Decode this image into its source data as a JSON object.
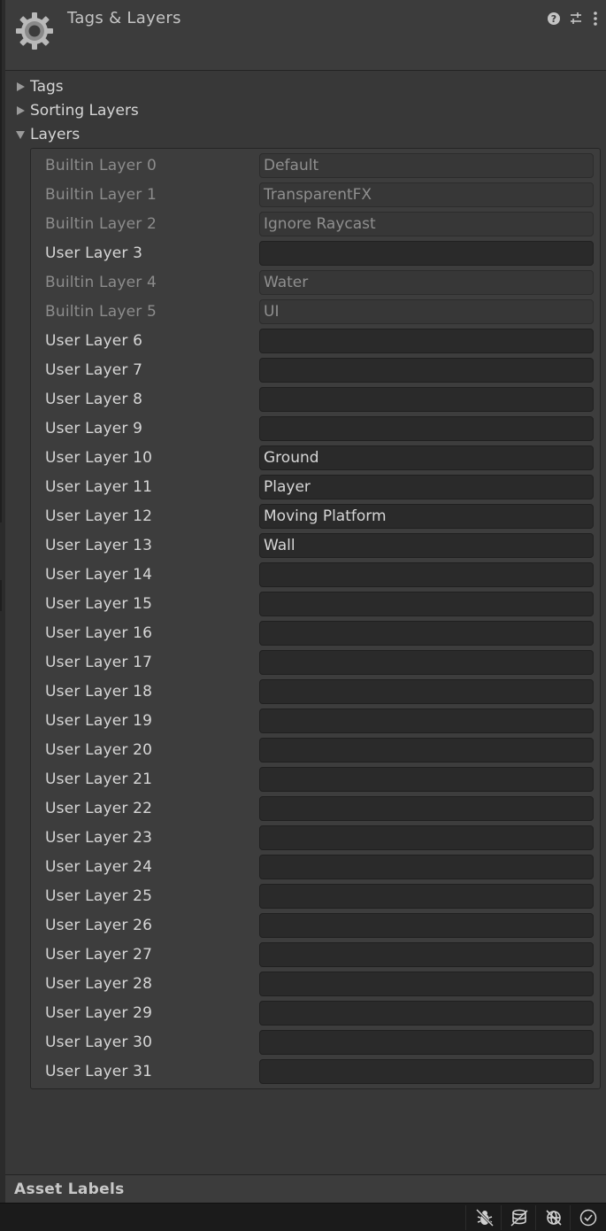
{
  "window": {
    "title": "Tags & Layers"
  },
  "header": {
    "icons": [
      "gear-icon",
      "help-icon",
      "preset-icon",
      "more-icon"
    ]
  },
  "foldouts": {
    "tags": "Tags",
    "sorting_layers": "Sorting Layers",
    "layers": "Layers"
  },
  "layers": [
    {
      "name": "Builtin Layer 0",
      "value": "Default",
      "builtin": true
    },
    {
      "name": "Builtin Layer 1",
      "value": "TransparentFX",
      "builtin": true
    },
    {
      "name": "Builtin Layer 2",
      "value": "Ignore Raycast",
      "builtin": true
    },
    {
      "name": "User Layer 3",
      "value": "",
      "builtin": false
    },
    {
      "name": "Builtin Layer 4",
      "value": "Water",
      "builtin": true
    },
    {
      "name": "Builtin Layer 5",
      "value": "UI",
      "builtin": true
    },
    {
      "name": "User Layer 6",
      "value": "",
      "builtin": false
    },
    {
      "name": "User Layer 7",
      "value": "",
      "builtin": false
    },
    {
      "name": "User Layer 8",
      "value": "",
      "builtin": false
    },
    {
      "name": "User Layer 9",
      "value": "",
      "builtin": false
    },
    {
      "name": "User Layer 10",
      "value": "Ground",
      "builtin": false
    },
    {
      "name": "User Layer 11",
      "value": "Player",
      "builtin": false
    },
    {
      "name": "User Layer 12",
      "value": "Moving Platform",
      "builtin": false
    },
    {
      "name": "User Layer 13",
      "value": "Wall",
      "builtin": false
    },
    {
      "name": "User Layer 14",
      "value": "",
      "builtin": false
    },
    {
      "name": "User Layer 15",
      "value": "",
      "builtin": false
    },
    {
      "name": "User Layer 16",
      "value": "",
      "builtin": false
    },
    {
      "name": "User Layer 17",
      "value": "",
      "builtin": false
    },
    {
      "name": "User Layer 18",
      "value": "",
      "builtin": false
    },
    {
      "name": "User Layer 19",
      "value": "",
      "builtin": false
    },
    {
      "name": "User Layer 20",
      "value": "",
      "builtin": false
    },
    {
      "name": "User Layer 21",
      "value": "",
      "builtin": false
    },
    {
      "name": "User Layer 22",
      "value": "",
      "builtin": false
    },
    {
      "name": "User Layer 23",
      "value": "",
      "builtin": false
    },
    {
      "name": "User Layer 24",
      "value": "",
      "builtin": false
    },
    {
      "name": "User Layer 25",
      "value": "",
      "builtin": false
    },
    {
      "name": "User Layer 26",
      "value": "",
      "builtin": false
    },
    {
      "name": "User Layer 27",
      "value": "",
      "builtin": false
    },
    {
      "name": "User Layer 28",
      "value": "",
      "builtin": false
    },
    {
      "name": "User Layer 29",
      "value": "",
      "builtin": false
    },
    {
      "name": "User Layer 30",
      "value": "",
      "builtin": false
    },
    {
      "name": "User Layer 31",
      "value": "",
      "builtin": false
    }
  ],
  "asset_labels": {
    "label": "Asset Labels"
  },
  "statusbar": {
    "icons": [
      "debug-off-icon",
      "cache-server-icon",
      "network-off-icon",
      "checkmark-icon"
    ]
  }
}
